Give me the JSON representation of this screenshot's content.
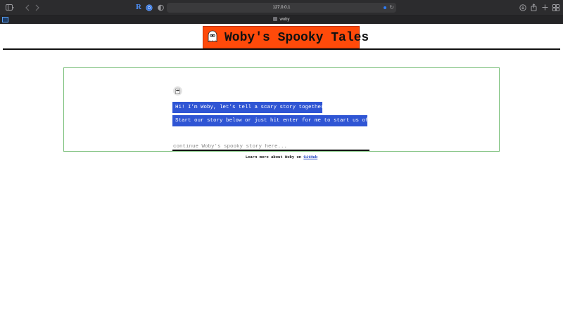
{
  "browser": {
    "address": "127.0.0.1",
    "tab_title": "woby",
    "toolbar_ext_letter": "R"
  },
  "header": {
    "title": "Woby's Spooky Tales",
    "bg_color": "#ff4a0a"
  },
  "chat": {
    "messages": [
      "Hi! I'm Woby, let's tell a scary story together.",
      "Start our story below or just hit enter for me to start us off."
    ],
    "input_placeholder": "continue Woby's spooky story here...",
    "bubble_color": "#2f55d4"
  },
  "footer": {
    "text": "Learn more about Woby on ",
    "link_text": "GitHub"
  }
}
